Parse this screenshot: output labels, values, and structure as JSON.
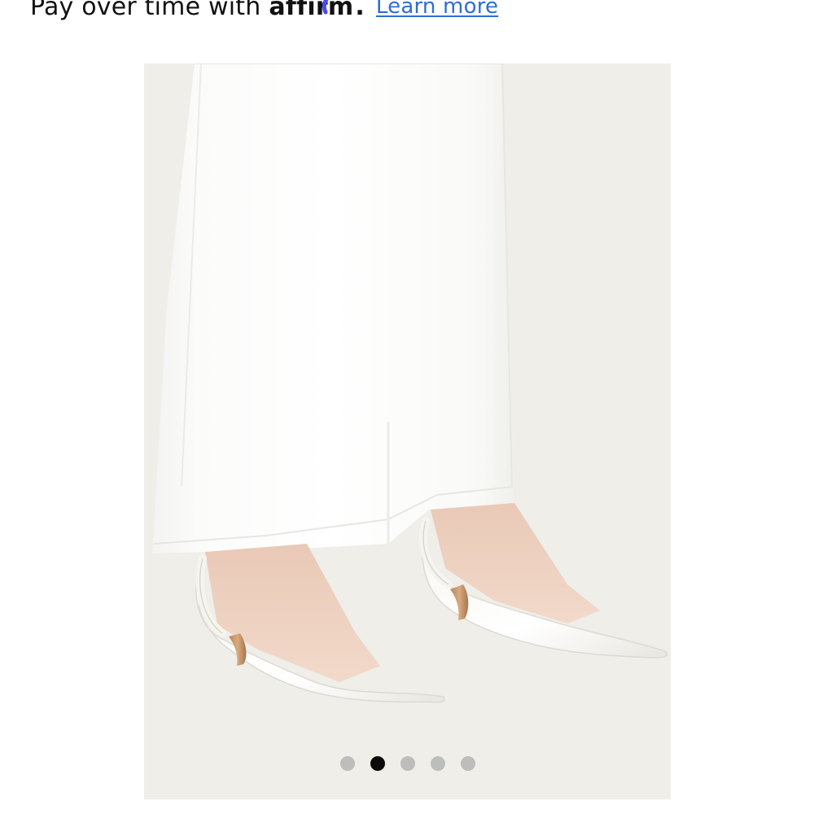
{
  "promo": {
    "lead_text": "Pay over time with",
    "brand_text": "affirm",
    "brand_suffix": ".",
    "link_text": "Learn more"
  },
  "gallery": {
    "image_alt": "White pointed-toe kitten heel slingback pumps",
    "slide_count": 5,
    "active_slide": 2
  },
  "colors": {
    "link": "#2d6fd2",
    "affirm_arc": "#4a4af4",
    "image_bg": "#efeee9",
    "dot_inactive": "#bdbdbb",
    "dot_active": "#0b0b0b"
  }
}
